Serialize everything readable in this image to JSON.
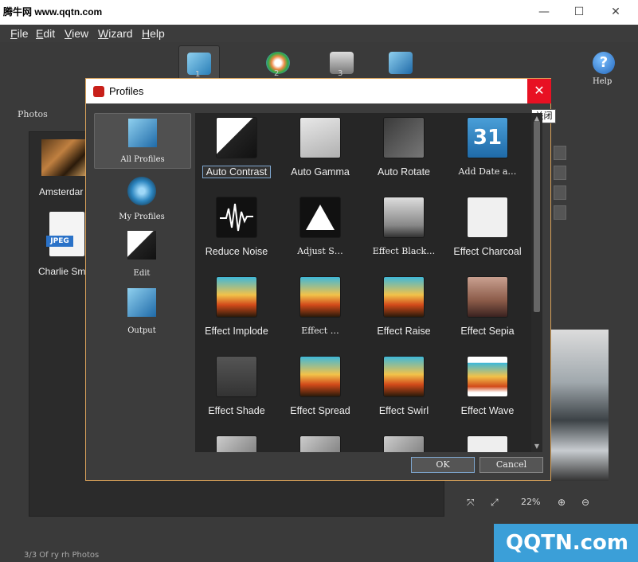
{
  "window": {
    "title": "腾牛网 www.qqtn.com",
    "controls": {
      "minimize": "—",
      "maximize": "☐",
      "close": "✕"
    }
  },
  "menu": [
    "File",
    "Edit",
    "View",
    "Wizard",
    "Help"
  ],
  "toolbar": {
    "steps": [
      {
        "num": "1",
        "icon": "photos-step-icon"
      },
      {
        "num": "2",
        "icon": "actions-step-icon"
      },
      {
        "num": "3",
        "icon": "output-step-icon"
      },
      {
        "num": "",
        "icon": "process-step-icon"
      }
    ],
    "help_label": "Help",
    "help_glyph": "?"
  },
  "main": {
    "photos_label": "Photos",
    "thumbnails": [
      {
        "label": "Amsterdar"
      },
      {
        "label": "Charlie Sm",
        "badge": "JPEG"
      }
    ],
    "zoom_level": "22%",
    "footer_text": "3/3     Of ry rh Photos"
  },
  "dialog": {
    "title": "Profiles",
    "close_tooltip": "关闭",
    "categories": [
      {
        "label": "All Profiles",
        "selected": true
      },
      {
        "label": "My Profiles",
        "selected": false
      },
      {
        "label": "Edit",
        "selected": false
      },
      {
        "label": "Output",
        "selected": false
      }
    ],
    "profiles": [
      {
        "label": "Auto Contrast",
        "icon": "wand-icon",
        "selected": true
      },
      {
        "label": "Auto Gamma",
        "icon": "gamma-chart-icon"
      },
      {
        "label": "Auto Rotate",
        "icon": "rotate-icon"
      },
      {
        "label": "Add Date a…",
        "icon": "calendar-31-icon",
        "date_glyph": "31"
      },
      {
        "label": "Reduce Noise",
        "icon": "noise-wave-icon"
      },
      {
        "label": "Adjust S…",
        "icon": "triangle-icon"
      },
      {
        "label": "Effect Black…",
        "icon": "palm-bw-icon"
      },
      {
        "label": "Effect Charcoal",
        "icon": "palm-charcoal-icon"
      },
      {
        "label": "Effect Implode",
        "icon": "palm-color-icon"
      },
      {
        "label": "Effect …",
        "icon": "palm-color-icon"
      },
      {
        "label": "Effect Raise",
        "icon": "palm-color-icon"
      },
      {
        "label": "Effect Sepia",
        "icon": "palm-sepia-icon"
      },
      {
        "label": "Effect Shade",
        "icon": "palm-shade-icon"
      },
      {
        "label": "Effect Spread",
        "icon": "palm-color-icon"
      },
      {
        "label": "Effect Swirl",
        "icon": "palm-color-icon"
      },
      {
        "label": "Effect Wave",
        "icon": "palm-wave-icon"
      }
    ],
    "ok_label": "OK",
    "cancel_label": "Cancel"
  },
  "watermark": {
    "brand": "QQTN.com",
    "tag": "腾牛网"
  }
}
